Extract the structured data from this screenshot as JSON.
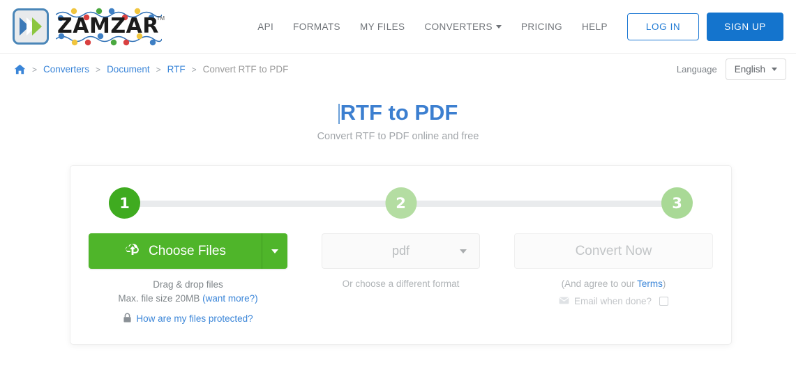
{
  "header": {
    "logo": {
      "word": "ZAMZAR",
      "tm": "TM",
      "name": "zamzar-logo"
    },
    "nav": [
      {
        "label": "API",
        "name": "nav-api",
        "caret": false
      },
      {
        "label": "FORMATS",
        "name": "nav-formats",
        "caret": false
      },
      {
        "label": "MY FILES",
        "name": "nav-my-files",
        "caret": false
      },
      {
        "label": "CONVERTERS",
        "name": "nav-converters",
        "caret": true
      },
      {
        "label": "PRICING",
        "name": "nav-pricing",
        "caret": false
      },
      {
        "label": "HELP",
        "name": "nav-help",
        "caret": false
      }
    ],
    "login_label": "LOG IN",
    "signup_label": "SIGN UP"
  },
  "breadcrumb": {
    "home_icon": "home-icon",
    "separator": ">",
    "items": [
      {
        "label": "Converters",
        "current": false
      },
      {
        "label": "Document",
        "current": false
      },
      {
        "label": "RTF",
        "current": false
      },
      {
        "label": "Convert RTF to PDF",
        "current": true
      }
    ]
  },
  "language": {
    "label": "Language",
    "selected": "English",
    "options": [
      "English"
    ]
  },
  "title": {
    "heading": "RTF to PDF",
    "subheading": "Convert RTF to PDF online and free"
  },
  "steps": [
    {
      "number": "1",
      "state": "active"
    },
    {
      "number": "2",
      "state": "inactive"
    },
    {
      "number": "3",
      "state": "inactive"
    }
  ],
  "step1": {
    "button_label": "Choose Files",
    "upload_icon": "cloud-upload-icon",
    "dropdown_icon": "chevron-down-icon",
    "drag_text": "Drag & drop files",
    "size_text": "Max. file size 20MB",
    "size_link": "(want more?)",
    "lock_icon": "lock-icon",
    "protect_link": "How are my files protected?"
  },
  "step2": {
    "format_value": "pdf",
    "caret_icon": "chevron-down-icon",
    "hint": "Or choose a different format"
  },
  "step3": {
    "convert_label": "Convert Now",
    "terms_prefix": "(And agree to our ",
    "terms_link": "Terms",
    "terms_suffix": ")",
    "email_icon": "envelope-icon",
    "email_label": "Email when done?",
    "email_checked": false
  },
  "colors": {
    "brand_blue": "#1474cd",
    "link_blue": "#3a85d8",
    "step_active_green": "#3fab20",
    "step_inactive_green": "#b4dda2",
    "choose_green": "#4fb52a",
    "title_blue": "#3c7fd0"
  }
}
